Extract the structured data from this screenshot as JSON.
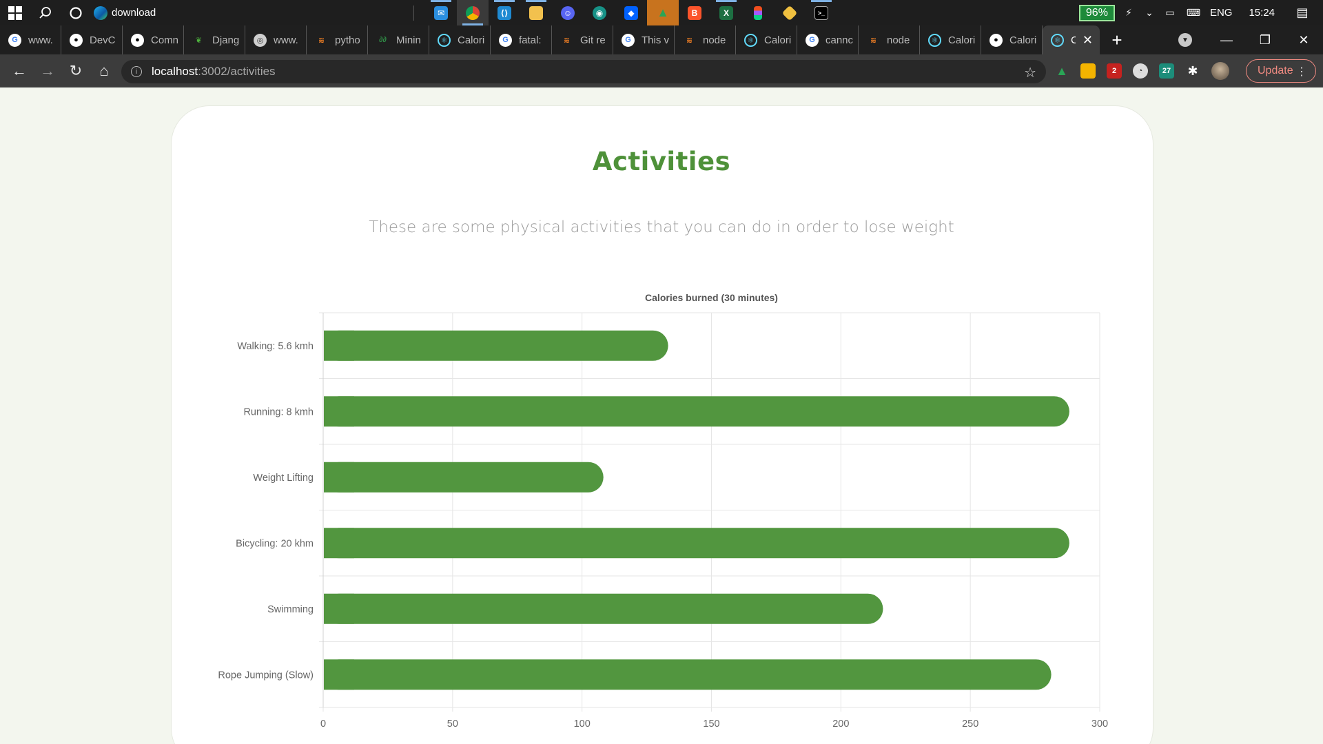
{
  "taskbar": {
    "app_title": "download",
    "battery": "96%",
    "language": "ENG",
    "time": "15:24"
  },
  "tabs": [
    {
      "label": "www.",
      "icon": "google-icon"
    },
    {
      "label": "DevC",
      "icon": "github-icon"
    },
    {
      "label": "Comn",
      "icon": "github-icon"
    },
    {
      "label": "Djang",
      "icon": "mongodb-leaf-icon"
    },
    {
      "label": "www.",
      "icon": "globe-icon"
    },
    {
      "label": "pytho",
      "icon": "stackoverflow-icon"
    },
    {
      "label": "Minin",
      "icon": "geeksforgeeks-icon"
    },
    {
      "label": "Calori",
      "icon": "react-icon"
    },
    {
      "label": "fatal:",
      "icon": "google-icon"
    },
    {
      "label": "Git re",
      "icon": "stackoverflow-icon"
    },
    {
      "label": "This v",
      "icon": "google-icon"
    },
    {
      "label": "node",
      "icon": "stackoverflow-icon"
    },
    {
      "label": "Calori",
      "icon": "react-icon"
    },
    {
      "label": "cannc",
      "icon": "google-icon"
    },
    {
      "label": "node",
      "icon": "stackoverflow-icon"
    },
    {
      "label": "Calori",
      "icon": "react-icon"
    },
    {
      "label": "Calori",
      "icon": "github-icon"
    },
    {
      "label": "Ca",
      "icon": "react-icon",
      "active": true
    }
  ],
  "toolbar": {
    "url_host": "localhost",
    "url_path": ":3002/activities",
    "update_label": "Update"
  },
  "page": {
    "title": "Activities",
    "subtitle": "These are some physical activities that you can do in order to lose weight"
  },
  "colors": {
    "accent": "#4e9139",
    "bar": "#52963f",
    "grid": "#e6e6e6"
  },
  "chart_data": {
    "type": "bar",
    "orientation": "horizontal",
    "title": "Calories burned (30 minutes)",
    "categories": [
      "Walking: 5.6 kmh",
      "Running: 8 kmh",
      "Weight Lifting",
      "Bicycling: 20 khm",
      "Swimming",
      "Rope Jumping (Slow)"
    ],
    "values": [
      133,
      288,
      108,
      288,
      216,
      281
    ],
    "xlim": [
      0,
      300
    ],
    "xticks": [
      0,
      50,
      100,
      150,
      200,
      250,
      300
    ],
    "grid": true,
    "legend": "none"
  }
}
